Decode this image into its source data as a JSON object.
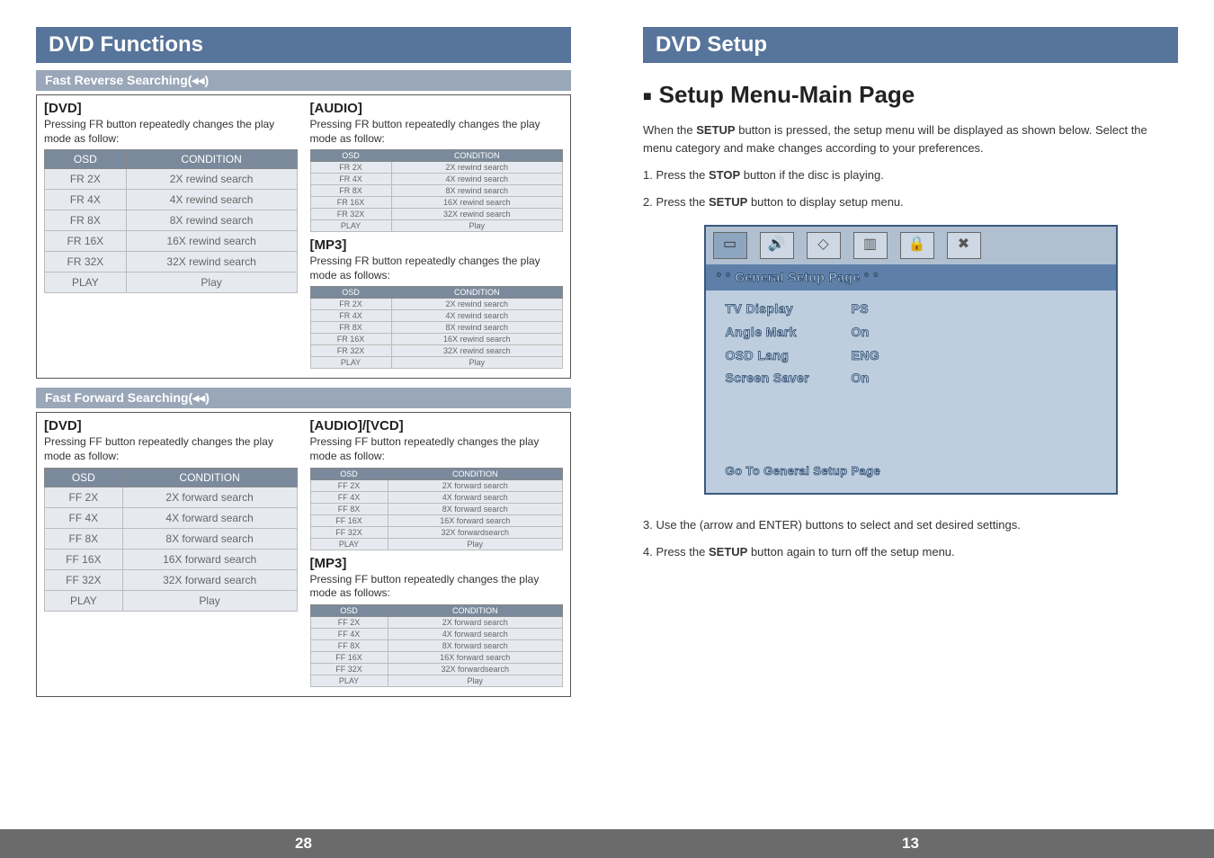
{
  "left": {
    "chapter": "DVD Functions",
    "page_no": "28",
    "fr": {
      "bar": "Fast Reverse Searching(◂◂)",
      "dvd": {
        "title": "[DVD]",
        "desc": "Pressing FR button repeatedly changes the play mode as follow:",
        "header": {
          "osd": "OSD",
          "cond": "CONDITION"
        },
        "rows": [
          {
            "osd": "FR 2X",
            "cond": "2X rewind search"
          },
          {
            "osd": "FR 4X",
            "cond": "4X rewind search"
          },
          {
            "osd": "FR 8X",
            "cond": "8X rewind search"
          },
          {
            "osd": "FR 16X",
            "cond": "16X rewind search"
          },
          {
            "osd": "FR 32X",
            "cond": "32X rewind search"
          },
          {
            "osd": "PLAY",
            "cond": "Play"
          }
        ]
      },
      "audio": {
        "title": "[AUDIO]",
        "desc": "Pressing FR button repeatedly changes the play mode as follow:",
        "header": {
          "osd": "OSD",
          "cond": "CONDITION"
        },
        "rows": [
          {
            "osd": "FR 2X",
            "cond": "2X rewind search"
          },
          {
            "osd": "FR 4X",
            "cond": "4X rewind search"
          },
          {
            "osd": "FR 8X",
            "cond": "8X rewind search"
          },
          {
            "osd": "FR 16X",
            "cond": "16X rewind search"
          },
          {
            "osd": "FR 32X",
            "cond": "32X rewind search"
          },
          {
            "osd": "PLAY",
            "cond": "Play"
          }
        ]
      },
      "mp3": {
        "title": "[MP3]",
        "desc": "Pressing FR button repeatedly changes the play mode as follows:",
        "header": {
          "osd": "OSD",
          "cond": "CONDITION"
        },
        "rows": [
          {
            "osd": "FR 2X",
            "cond": "2X rewind search"
          },
          {
            "osd": "FR 4X",
            "cond": "4X rewind search"
          },
          {
            "osd": "FR 8X",
            "cond": "8X rewind search"
          },
          {
            "osd": "FR 16X",
            "cond": "16X rewind search"
          },
          {
            "osd": "FR 32X",
            "cond": "32X rewind search"
          },
          {
            "osd": "PLAY",
            "cond": "Play"
          }
        ]
      }
    },
    "ff": {
      "bar": "Fast Forward Searching(◂◂)",
      "dvd": {
        "title": "[DVD]",
        "desc": "Pressing FF button repeatedly changes the play mode as follow:",
        "header": {
          "osd": "OSD",
          "cond": "CONDITION"
        },
        "rows": [
          {
            "osd": "FF 2X",
            "cond": "2X forward search"
          },
          {
            "osd": "FF 4X",
            "cond": "4X forward search"
          },
          {
            "osd": "FF 8X",
            "cond": "8X forward search"
          },
          {
            "osd": "FF 16X",
            "cond": "16X forward search"
          },
          {
            "osd": "FF 32X",
            "cond": "32X forward search"
          },
          {
            "osd": "PLAY",
            "cond": "Play"
          }
        ]
      },
      "audio": {
        "title": "[AUDIO]/[VCD]",
        "desc": "Pressing FF button repeatedly changes the play mode as follow:",
        "header": {
          "osd": "OSD",
          "cond": "CONDITION"
        },
        "rows": [
          {
            "osd": "FF 2X",
            "cond": "2X forward search"
          },
          {
            "osd": "FF 4X",
            "cond": "4X forward search"
          },
          {
            "osd": "FF 8X",
            "cond": "8X forward search"
          },
          {
            "osd": "FF 16X",
            "cond": "16X forward search"
          },
          {
            "osd": "FF 32X",
            "cond": "32X forwardsearch"
          },
          {
            "osd": "PLAY",
            "cond": "Play"
          }
        ]
      },
      "mp3": {
        "title": "[MP3]",
        "desc": "Pressing FF button repeatedly changes the play mode as follows:",
        "header": {
          "osd": "OSD",
          "cond": "CONDITION"
        },
        "rows": [
          {
            "osd": "FF 2X",
            "cond": "2X forward search"
          },
          {
            "osd": "FF 4X",
            "cond": "4X forward search"
          },
          {
            "osd": "FF 8X",
            "cond": "8X forward search"
          },
          {
            "osd": "FF 16X",
            "cond": "16X forward search"
          },
          {
            "osd": "FF 32X",
            "cond": "32X forwardsearch"
          },
          {
            "osd": "PLAY",
            "cond": "Play"
          }
        ]
      }
    }
  },
  "right": {
    "chapter": "DVD Setup",
    "page_no": "13",
    "heading": "Setup Menu-Main Page",
    "intro": "When the SETUP button is pressed, the setup menu will be displayed as shown below. Select the menu category and make changes according to your preferences.",
    "step1_a": "1. Press the ",
    "step1_b": "STOP",
    "step1_c": " button if the disc is playing.",
    "step2_a": "2. Press the ",
    "step2_b": "SETUP",
    "step2_c": " button to display setup menu.",
    "screen": {
      "tabbar": "° ° General Setup Page ° °",
      "rows": [
        {
          "k": "TV Display",
          "v": "PS"
        },
        {
          "k": "Angle Mark",
          "v": "On"
        },
        {
          "k": "OSD Lang",
          "v": "ENG"
        },
        {
          "k": "Screen Saver",
          "v": "On"
        }
      ],
      "foot": "Go To General Setup Page"
    },
    "step3": "3. Use the (arrow and ENTER) buttons to select and set desired settings.",
    "step4_a": "4. Press the ",
    "step4_b": "SETUP",
    "step4_c": " button again to turn off the setup menu."
  }
}
